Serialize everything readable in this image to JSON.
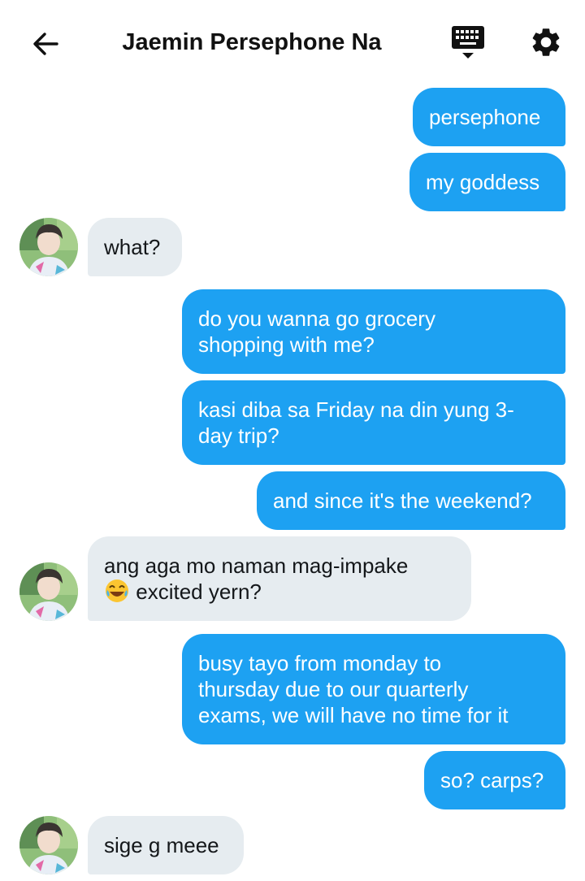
{
  "header": {
    "title": "Jaemin Persephone Na",
    "back_icon": "arrow-left-icon",
    "keyboard_icon": "keyboard-icon",
    "settings_icon": "gear-icon"
  },
  "colors": {
    "outgoing_bubble": "#1da1f2",
    "incoming_bubble": "#e6ecf0"
  },
  "messages": [
    {
      "from": "me",
      "lines": [
        "persephone"
      ]
    },
    {
      "from": "me",
      "lines": [
        "my goddess"
      ]
    },
    {
      "from": "them",
      "lines": [
        "what?"
      ]
    },
    {
      "from": "me",
      "lines": [
        "do you wanna go grocery",
        "shopping with me?"
      ]
    },
    {
      "from": "me",
      "lines": [
        "kasi diba sa Friday na din yung 3-",
        "day trip?"
      ]
    },
    {
      "from": "me",
      "lines": [
        "and since it's the weekend?"
      ]
    },
    {
      "from": "them",
      "lines": [
        "ang aga mo naman mag-impake",
        "excited yern?"
      ],
      "emoji": "😂"
    },
    {
      "from": "me",
      "lines": [
        "busy tayo from monday to",
        "thursday due to our quarterly",
        "exams, we will have no time for it"
      ]
    },
    {
      "from": "me",
      "lines": [
        "so? carps?"
      ]
    },
    {
      "from": "them",
      "lines": [
        "sige g meee"
      ]
    }
  ]
}
